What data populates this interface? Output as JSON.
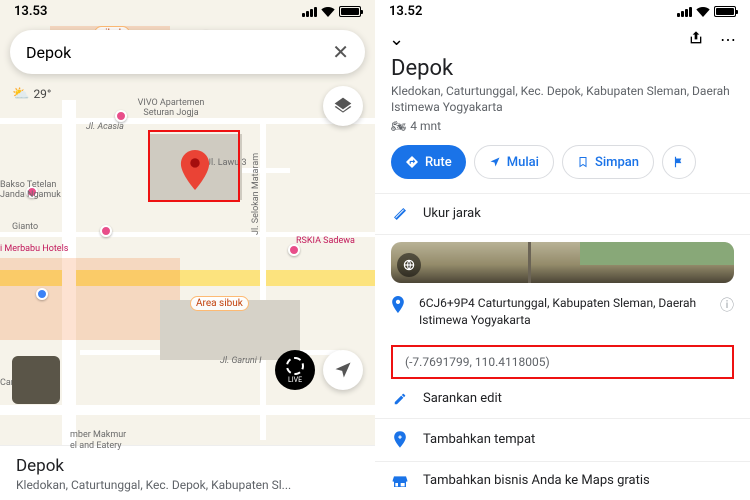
{
  "left": {
    "status_time": "13.53",
    "search_value": "Depok",
    "weather": "29°",
    "labels": {
      "busy_top": "sibuk",
      "vivo": "VIVO Apartemen Seturan Jogja",
      "acacia": "Jl. Acasia",
      "bakso": "Bakso Tetelan Janda Ngamuk",
      "gianto": "Gianto",
      "lawu": "Jl. Lawu 3",
      "merbabu": "i Merbabu Hotels",
      "rskia": "RSKIA Sadewa",
      "selokan": "Jl. Selokan Mataram",
      "busy_area": "Area sibuk",
      "carroll": "Carroll Offni",
      "garuni": "Jl. Garuni I",
      "makmur1": "mber Makmur",
      "makmur2": "el and Eatery",
      "live": "LIVE"
    },
    "sheet_title": "Depok",
    "sheet_sub": "Kledokan, Caturtunggal, Kec. Depok, Kabupaten Sl..."
  },
  "right": {
    "status_time": "13.52",
    "title": "Depok",
    "subtitle": "Kledokan, Caturtunggal, Kec. Depok, Kabupaten Sleman, Daerah Istimewa Yogyakarta",
    "duration": "4 mnt",
    "btn_rute": "Rute",
    "btn_mulai": "Mulai",
    "btn_simpan": "Simpan",
    "measure": "Ukur jarak",
    "pluscode": "6CJ6+9P4 Caturtunggal, Kabupaten Sleman, Daerah Istimewa Yogyakarta",
    "coords": "(-7.7691799, 110.4118005)",
    "suggest": "Sarankan edit",
    "addplace": "Tambahkan tempat",
    "addbiz": "Tambahkan bisnis Anda ke Maps gratis"
  }
}
